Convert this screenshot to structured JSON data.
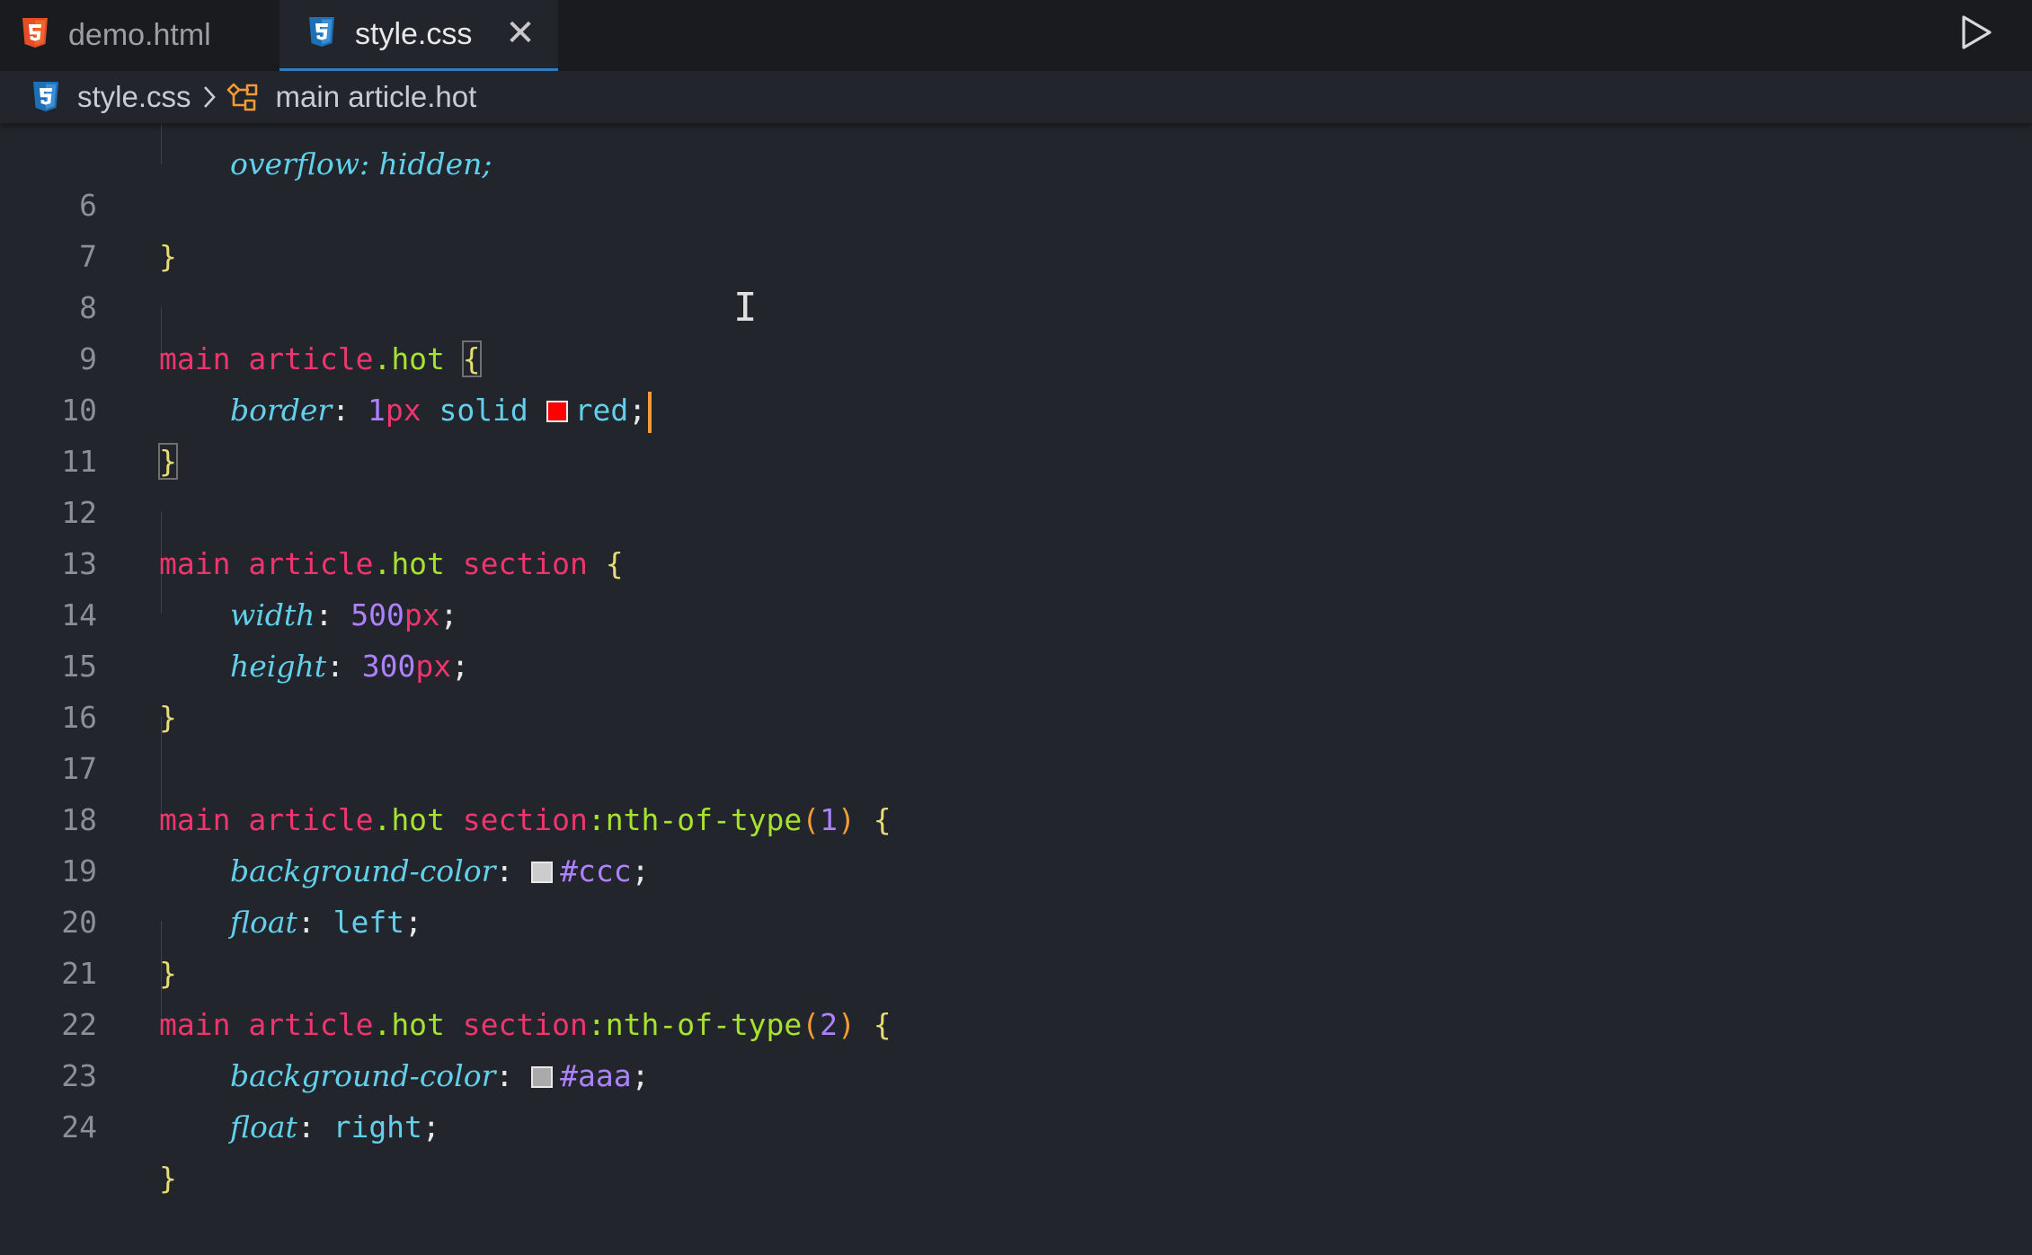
{
  "tabs": [
    {
      "label": "demo.html",
      "icon": "html5-icon",
      "active": false
    },
    {
      "label": "style.css",
      "icon": "css3-icon",
      "active": true,
      "close_icon": "close-icon"
    }
  ],
  "tab_close_glyph": "✕",
  "run_icon": "play-icon",
  "breadcrumb": {
    "file": "style.css",
    "file_icon": "css3-icon",
    "separator_icon": "chevron-right-icon",
    "symbol_icon": "selector-symbol-icon",
    "symbol": "main article.hot"
  },
  "colors": {
    "selector": "#f0356e",
    "class": "#a6e22e",
    "brace": "#e6db74",
    "property": "#62d0ea",
    "number": "#ae81ff",
    "cursor": "#f39b34",
    "css_badge": "#2f7fc4",
    "html_badge": "#e44d26"
  },
  "editor": {
    "partial_top_line": "overflow: hidden;",
    "lines": {
      "l6": {
        "num": "6",
        "brace": "}"
      },
      "l7": {
        "num": "7"
      },
      "l8": {
        "num": "8",
        "tag": "main",
        "tag2": "article",
        "dot": ".",
        "cls": "hot",
        "brace": "{"
      },
      "l9": {
        "num": "9",
        "prop": "border",
        "colon": ": ",
        "n": "1",
        "unit": "px",
        "val": " solid ",
        "swatch": "#ff0000",
        "val2": "red",
        "semi": ";"
      },
      "l10": {
        "num": "10",
        "brace": "}"
      },
      "l11": {
        "num": "11"
      },
      "l12": {
        "num": "12",
        "tag": "main",
        "tag2": "article",
        "dot": ".",
        "cls": "hot",
        "tag3": "section",
        "brace": "{"
      },
      "l13": {
        "num": "13",
        "prop": "width",
        "colon": ": ",
        "n": "500",
        "unit": "px",
        "semi": ";"
      },
      "l14": {
        "num": "14",
        "prop": "height",
        "colon": ": ",
        "n": "300",
        "unit": "px",
        "semi": ";"
      },
      "l15": {
        "num": "15",
        "brace": "}"
      },
      "l16": {
        "num": "16"
      },
      "l17": {
        "num": "17",
        "tag": "main",
        "tag2": "article",
        "dot": ".",
        "cls": "hot",
        "tag3": "section",
        "pseudo": ":nth-of-type",
        "po": "(",
        "arg": "1",
        "pc": ")",
        "brace": "{"
      },
      "l18": {
        "num": "18",
        "prop": "background-color",
        "colon": ": ",
        "swatch": "#cccccc",
        "hex": "#ccc",
        "semi": ";"
      },
      "l19": {
        "num": "19",
        "prop": "float",
        "colon": ": ",
        "val": "left",
        "semi": ";"
      },
      "l20": {
        "num": "20",
        "brace": "}"
      },
      "l21": {
        "num": "21",
        "tag": "main",
        "tag2": "article",
        "dot": ".",
        "cls": "hot",
        "tag3": "section",
        "pseudo": ":nth-of-type",
        "po": "(",
        "arg": "2",
        "pc": ")",
        "brace": "{"
      },
      "l22": {
        "num": "22",
        "prop": "background-color",
        "colon": ": ",
        "swatch": "#aaaaaa",
        "hex": "#aaa",
        "semi": ";"
      },
      "l23": {
        "num": "23",
        "prop": "float",
        "colon": ": ",
        "val": "right",
        "semi": ";"
      },
      "l24": {
        "num": "24",
        "brace": "}"
      }
    }
  },
  "mouse_pointer": "text-cursor-icon",
  "mouse_glyph": "I"
}
